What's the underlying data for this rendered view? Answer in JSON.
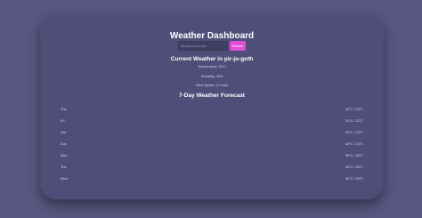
{
  "header": {
    "title": "Weather Dashboard"
  },
  "search": {
    "placeholder": "Search for a city",
    "value": "",
    "button_label": "Search"
  },
  "current": {
    "title": "Current Weather in pir-jo-goth",
    "temperature": "Temperature: 32°C",
    "humidity": "Humidity: 40%",
    "wind": "Wind Speed: 12 km/h"
  },
  "forecast": {
    "title": "7-Day Weather Forecast",
    "days": [
      {
        "day": "Thu",
        "range": "32°C / 23°C"
      },
      {
        "day": "Fri",
        "range": "31°C / 22°C"
      },
      {
        "day": "Sat",
        "range": "33°C / 23°C"
      },
      {
        "day": "Sun",
        "range": "34°C / 24°C"
      },
      {
        "day": "Mon",
        "range": "36°C / 26°C"
      },
      {
        "day": "Thu",
        "range": "36°C / 28°C"
      },
      {
        "day": "Wed",
        "range": "36°C / 28°C"
      }
    ]
  },
  "colors": {
    "background": "#575781",
    "card": "#4e4e78",
    "accent": "#e24fd6"
  }
}
